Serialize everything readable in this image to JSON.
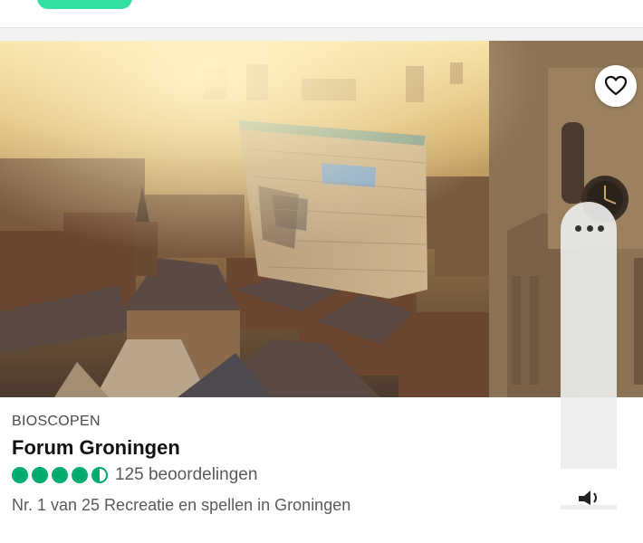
{
  "header": {
    "accent_color": "#34e0a1"
  },
  "listing": {
    "category": "BIOSCOPEN",
    "name": "Forum Groningen",
    "rating": 4.5,
    "rating_max": 5,
    "rating_color": "#00aa6c",
    "reviews_text": "125 beoordelingen",
    "rank_text": "Nr. 1 van 25 Recreatie en spellen in Groningen"
  },
  "icons": {
    "save": "heart-icon",
    "more": "more-dots-icon",
    "sound": "speaker-icon"
  }
}
